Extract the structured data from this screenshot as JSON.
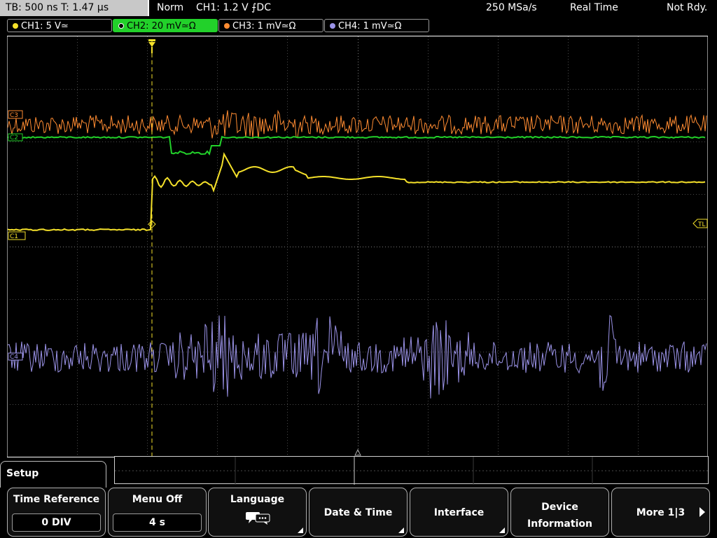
{
  "topbar": {
    "tb_label": "TB: 500 ns   T: 1.47 µs",
    "mode": "Norm",
    "trigger": "CH1: 1.2 V ⨍DC",
    "sample_rate": "250 MSa/s",
    "acq_mode": "Real Time",
    "status": "Not Rdy."
  },
  "channels": [
    {
      "label": "CH1: 5 V≃",
      "color": "#f5e12a",
      "active": false
    },
    {
      "label": "CH2: 20 mV≃Ω",
      "color": "#22d12a",
      "active": true
    },
    {
      "label": "CH3: 1 mV≃Ω",
      "color": "#ff8c32",
      "active": false
    },
    {
      "label": "CH4: 1 mV≃Ω",
      "color": "#9b93e8",
      "active": false
    }
  ],
  "markers": {
    "c3": "C3",
    "c2": "C2",
    "c1": "C1",
    "c4": "C4",
    "trigger_level": "TL"
  },
  "menu": {
    "title": "Setup",
    "softkeys": [
      {
        "label": "Time Reference",
        "value": "0 DIV"
      },
      {
        "label": "Menu Off",
        "value": "4 s"
      },
      {
        "label": "Language",
        "icon": "speech-bubbles-icon"
      },
      {
        "label": "Date & Time"
      },
      {
        "label": "Interface"
      },
      {
        "label": "Device",
        "label2": "Information"
      },
      {
        "label": "More 1|3"
      }
    ]
  },
  "colors": {
    "ch1": "#f5e12a",
    "ch2": "#22d12a",
    "ch3": "#ff8c32",
    "ch4": "#9b93e8",
    "grid": "#5a5a5a",
    "trigger_line": "#f5e12a"
  }
}
